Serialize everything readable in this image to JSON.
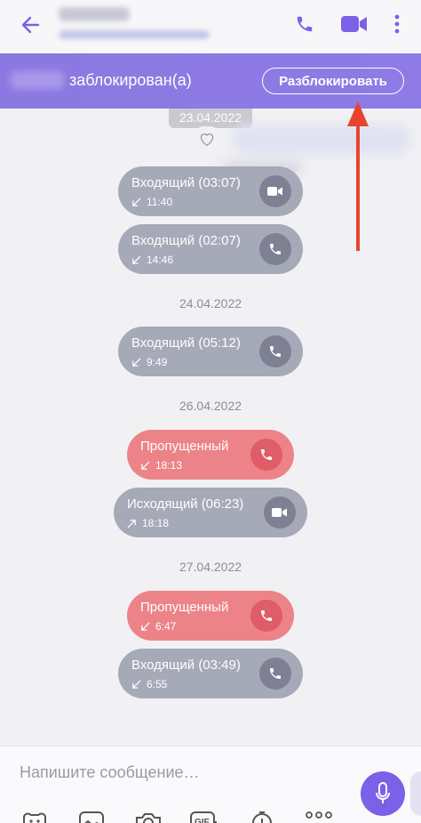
{
  "header": {
    "back_icon": "arrow-left-icon",
    "call_icon": "phone-icon",
    "video_icon": "video-camera-icon",
    "more_icon": "vertical-dots-icon",
    "accent_color": "#7b61e8"
  },
  "block_banner": {
    "text": "заблокирован(а)",
    "unblock_label": "Разблокировать",
    "background": "#8b78e0"
  },
  "chat": {
    "dates": [
      "23.04.2022",
      "24.04.2022",
      "26.04.2022",
      "27.04.2022"
    ],
    "calls": [
      {
        "label": "Входящий (03:07)",
        "time": "11:40",
        "direction": "incoming",
        "type": "video",
        "status": "answered"
      },
      {
        "label": "Входящий (02:07)",
        "time": "14:46",
        "direction": "incoming",
        "type": "voice",
        "status": "answered"
      },
      {
        "label": "Входящий (05:12)",
        "time": "9:49",
        "direction": "incoming",
        "type": "voice",
        "status": "answered"
      },
      {
        "label": "Пропущенный",
        "time": "18:13",
        "direction": "incoming",
        "type": "voice",
        "status": "missed"
      },
      {
        "label": "Исходящий (06:23)",
        "time": "18:18",
        "direction": "outgoing",
        "type": "video",
        "status": "answered"
      },
      {
        "label": "Пропущенный",
        "time": "6:47",
        "direction": "incoming",
        "type": "voice",
        "status": "missed"
      },
      {
        "label": "Входящий (03:49)",
        "time": "6:55",
        "direction": "incoming",
        "type": "voice",
        "status": "answered"
      }
    ],
    "colors": {
      "answered": "#a6a9b8",
      "missed": "#ec8388"
    }
  },
  "composer": {
    "placeholder": "Напишите сообщение…",
    "tools": [
      "sticker-icon",
      "gallery-icon",
      "camera-icon",
      "gif-icon",
      "timer-icon",
      "more-dots-icon"
    ],
    "mic_icon": "microphone-icon"
  }
}
